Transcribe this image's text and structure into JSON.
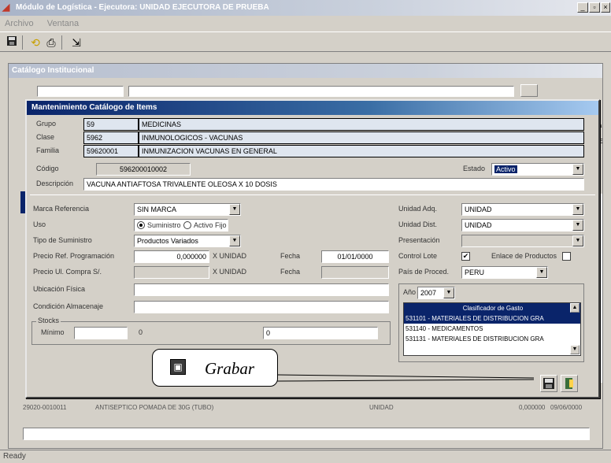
{
  "app": {
    "title": "Módulo de Logística  - Ejecutora: UNIDAD EJECUTORA DE PRUEBA",
    "window_buttons": [
      "_",
      "▫",
      "×"
    ]
  },
  "menu": [
    "Archivo",
    "Ventana"
  ],
  "toolbar": {
    "icons": [
      "save-icon",
      "refresh-icon",
      "print-icon",
      "exit-icon"
    ]
  },
  "child": {
    "title": "Catálogo Institucional",
    "status_text": "Ready",
    "bg_row": {
      "code": "29020-0010011",
      "desc": "ANTISEPTICO POMADA DE 30G (TUBO)",
      "unit": "UNIDAD",
      "price": "0,000000",
      "date": "09/06/0000"
    },
    "side_fragments": [
      "Va",
      "VE"
    ]
  },
  "dialog": {
    "title": "Mantenimiento Catálogo de Items",
    "grupo": {
      "label": "Grupo",
      "code": "59",
      "name": "MEDICINAS"
    },
    "clase": {
      "label": "Clase",
      "code": "5962",
      "name": "INMUNOLOGICOS - VACUNAS"
    },
    "familia": {
      "label": "Familia",
      "code": "59620001",
      "name": "INMUNIZACION VACUNAS EN GENERAL"
    },
    "codigo": {
      "label": "Código",
      "value": "596200010002"
    },
    "estado": {
      "label": "Estado",
      "value": "Activo"
    },
    "descripcion": {
      "label": "Descripción",
      "value": "VACUNA ANTIAFTOSA TRIVALENTE OLEOSA X 10 DOSIS"
    },
    "marca": {
      "label": "Marca Referencia",
      "value": "SIN MARCA"
    },
    "uso": {
      "label": "Uso",
      "opt1": "Suministro",
      "opt2": "Activo Fijo"
    },
    "tipo_suministro": {
      "label": "Tipo de Suministro",
      "value": "Productos Variados"
    },
    "precio_ref": {
      "label": "Precio Ref. Programación",
      "value": "0,000000",
      "unit": "X UNIDAD"
    },
    "fecha1": {
      "label": "Fecha",
      "value": "01/01/0000"
    },
    "precio_ult": {
      "label": "Precio Ul. Compra S/.",
      "value": "",
      "unit": "X UNIDAD"
    },
    "fecha2": {
      "label": "Fecha",
      "value": ""
    },
    "ubicacion": {
      "label": "Ubicación Física",
      "value": ""
    },
    "condicion": {
      "label": "Condición Almacenaje",
      "value": ""
    },
    "stocks": {
      "label": "Stocks",
      "minimo_label": "Mínimo",
      "minimo_value": "",
      "zero": "0",
      "max_value": "0"
    },
    "unidad_adq": {
      "label": "Unidad Adq.",
      "value": "UNIDAD"
    },
    "unidad_dist": {
      "label": "Unidad Dist.",
      "value": "UNIDAD"
    },
    "presentacion": {
      "label": "Presentación",
      "value": ""
    },
    "control_lote": {
      "label": "Control Lote",
      "checked": "✔"
    },
    "enlace_productos": {
      "label": "Enlace de Productos",
      "checked": ""
    },
    "pais": {
      "label": "País de Proced.",
      "value": "PERU"
    },
    "anio": {
      "label": "Año",
      "value": "2007"
    },
    "clasificador": {
      "header": "Clasificador de Gasto",
      "rows": [
        "531101 - MATERIALES DE DISTRIBUCION GRA",
        "531140 - MEDICAMENTOS",
        "531131 - MATERIALES DE DISTRIBUCION GRA"
      ]
    }
  },
  "callout": {
    "text": "Grabar"
  },
  "colors": {
    "dialog_title_start": "#0a246a",
    "dialog_title_end": "#a6caf0",
    "list_selected": "#0a246a",
    "grid_field": "#dfe6ef"
  }
}
